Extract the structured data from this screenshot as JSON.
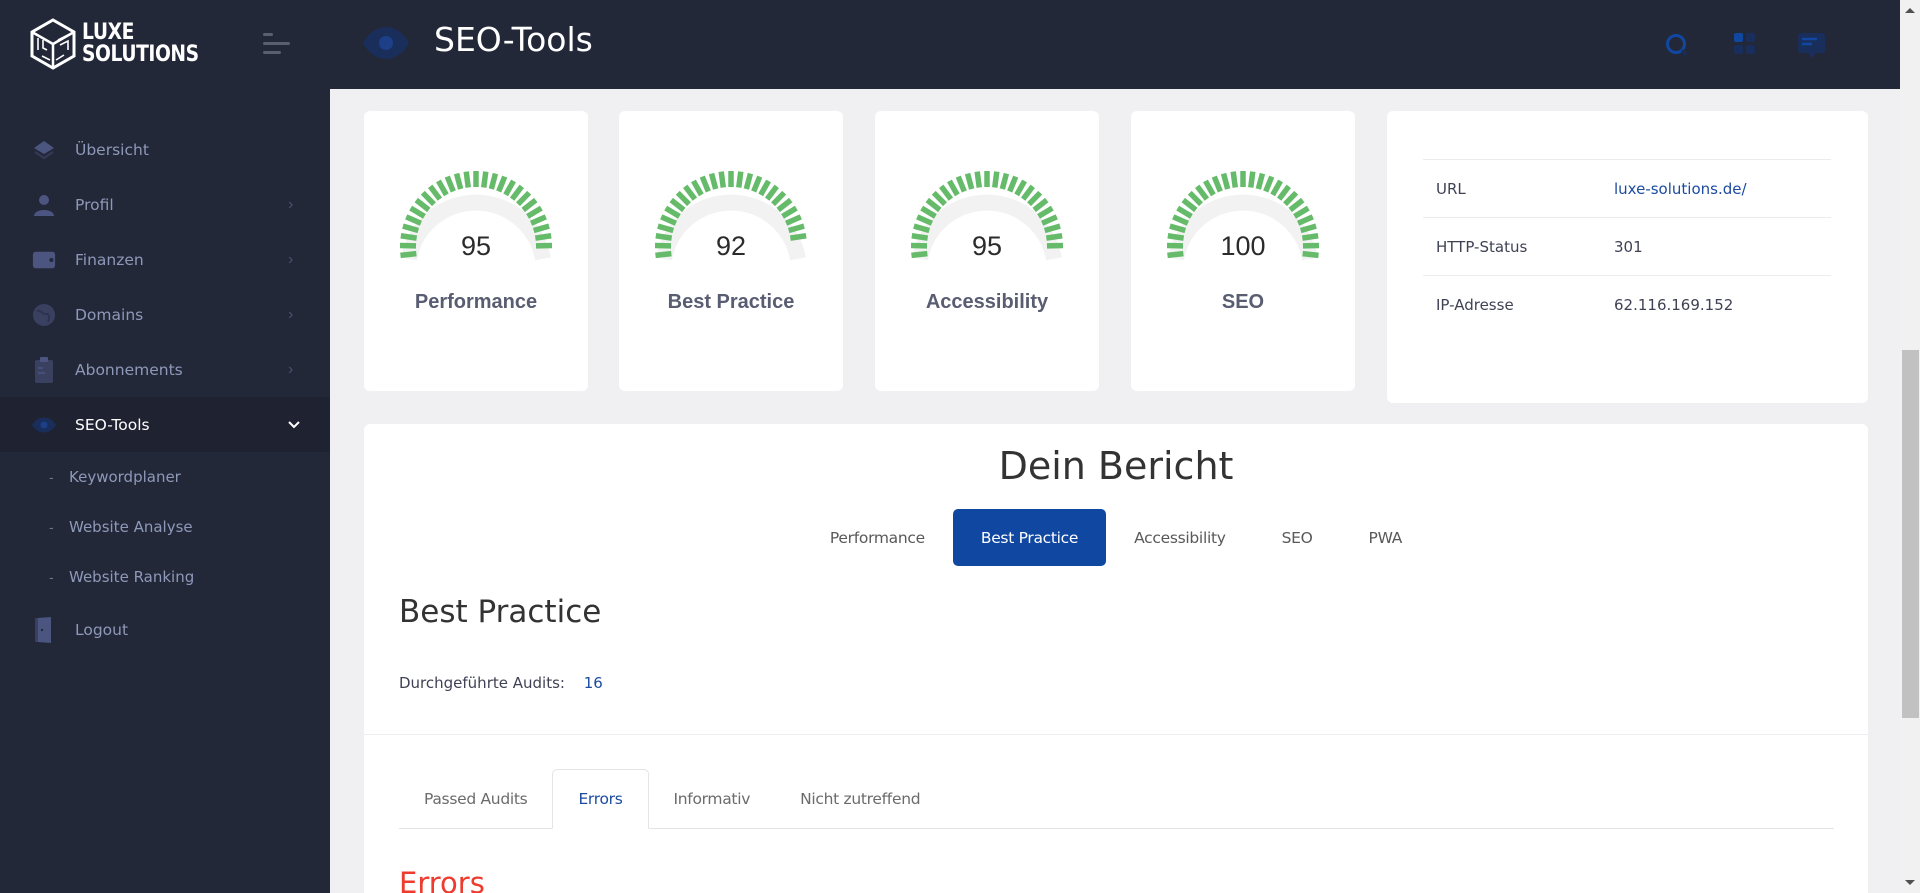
{
  "brand": {
    "line1": "LUXE",
    "line2": "SOLUTIONS"
  },
  "header": {
    "title": "SEO-Tools",
    "icons": [
      "search-icon",
      "grid-icon",
      "chat-icon"
    ]
  },
  "sidebar": {
    "items": [
      {
        "label": "Übersicht",
        "icon": "layers-icon",
        "has_chevron": false
      },
      {
        "label": "Profil",
        "icon": "user-icon",
        "has_chevron": true
      },
      {
        "label": "Finanzen",
        "icon": "wallet-icon",
        "has_chevron": true
      },
      {
        "label": "Domains",
        "icon": "globe-icon",
        "has_chevron": true
      },
      {
        "label": "Abonnements",
        "icon": "clipboard-icon",
        "has_chevron": true
      },
      {
        "label": "SEO-Tools",
        "icon": "eye-icon",
        "has_chevron": true,
        "active": true,
        "expanded": true
      }
    ],
    "sub_items": [
      {
        "label": "Keywordplaner"
      },
      {
        "label": "Website Analyse"
      },
      {
        "label": "Website Ranking"
      }
    ],
    "logout": {
      "label": "Logout",
      "icon": "door-icon"
    }
  },
  "scores": [
    {
      "label": "Performance",
      "value": 95
    },
    {
      "label": "Best Practice",
      "value": 92
    },
    {
      "label": "Accessibility",
      "value": 95
    },
    {
      "label": "SEO",
      "value": 100
    }
  ],
  "gauge_colors": {
    "filled": "#66bb6a",
    "empty": "#f2f2f2"
  },
  "info": {
    "rows": [
      {
        "key": "URL",
        "value": "luxe-solutions.de/",
        "is_link": true
      },
      {
        "key": "HTTP-Status",
        "value": "301"
      },
      {
        "key": "IP-Adresse",
        "value": "62.116.169.152"
      }
    ]
  },
  "report": {
    "title": "Dein Bericht",
    "pills": [
      "Performance",
      "Best Practice",
      "Accessibility",
      "SEO",
      "PWA"
    ],
    "active_pill": "Best Practice",
    "section_title": "Best Practice",
    "audits_label": "Durchgeführte Audits:",
    "audits_count": "16",
    "tabs": [
      "Passed Audits",
      "Errors",
      "Informativ",
      "Nicht zutreffend"
    ],
    "active_tab": "Errors",
    "errors_title": "Errors"
  },
  "colors": {
    "accent": "#0f47a1",
    "sidebar_bg": "#232839",
    "error": "#ee3b2e",
    "link": "#1c4ba0"
  }
}
